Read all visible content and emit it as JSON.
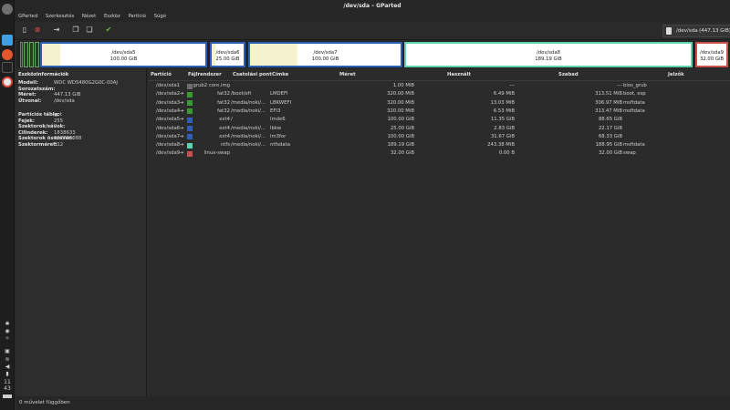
{
  "window": {
    "title": "/dev/sda – GParted"
  },
  "menu": [
    "GParted",
    "Szerkesztés",
    "Nézet",
    "Eszköz",
    "Partíció",
    "Súgó"
  ],
  "device_selector": {
    "name": "/dev/sda",
    "size": "(447.13 GiB)"
  },
  "disk_segments": [
    {
      "name": "/dev/sda5",
      "size": "100.00 GiB",
      "used_fraction": 0.113,
      "color": "#2f5fb4"
    },
    {
      "name": "/dev/sda6",
      "size": "25.00 GiB",
      "used_fraction": 0.11,
      "color": "#2f5fb4"
    },
    {
      "name": "/dev/sda7",
      "size": "100.00 GiB",
      "used_fraction": 0.317,
      "color": "#2f5fb4"
    },
    {
      "name": "/dev/sda8",
      "size": "189.19 GiB",
      "used_fraction": 0.0,
      "color": "#5fd2b0"
    },
    {
      "name": "/dev/sda9",
      "size": "32.00 GiB",
      "used_fraction": 0.0,
      "color": "#c9524e"
    }
  ],
  "info": {
    "title": "Eszközinformációk",
    "fields": [
      {
        "k": "Modell:",
        "v": "WDC WDS480G2G0C-00AJ"
      },
      {
        "k": "Sorozatszám:",
        "v": ""
      },
      {
        "k": "Méret:",
        "v": "447.13 GiB"
      },
      {
        "k": "Útvonal:",
        "v": "/dev/sda"
      }
    ],
    "fields2": [
      {
        "k": "Partíciós tábla:",
        "v": "gpt"
      },
      {
        "k": "Fejek:",
        "v": "255"
      },
      {
        "k": "Szektorok/sávok:",
        "v": "2"
      },
      {
        "k": "Cilinderek:",
        "v": "1838633"
      },
      {
        "k": "Szektorok összesen:",
        "v": "937703088"
      },
      {
        "k": "Szektorméret:",
        "v": "512"
      }
    ]
  },
  "columns": [
    "Partíció",
    "Fájlrendszer",
    "Csatolási pont",
    "Címke",
    "Méret",
    "Használt",
    "Szabad",
    "Jelzők"
  ],
  "rows": [
    {
      "part": "/dev/sda1",
      "fs": "grub2 core.img",
      "mount": "",
      "label": "",
      "size": "1.00 MiB",
      "used": "---",
      "free": "---",
      "flags": "bios_grub",
      "color": "#6e6e6e",
      "key": false
    },
    {
      "part": "/dev/sda2",
      "fs": "fat32",
      "mount": "/boot/efi",
      "label": "LMDEFI",
      "size": "320.00 MiB",
      "used": "6.49 MiB",
      "free": "313.51 MiB",
      "flags": "boot, esp",
      "color": "#3a9b35",
      "key": true
    },
    {
      "part": "/dev/sda3",
      "fs": "fat32",
      "mount": "/media/noki/...",
      "label": "LBKWEFI",
      "size": "320.00 MiB",
      "used": "13.03 MiB",
      "free": "306.97 MiB",
      "flags": "msftdata",
      "color": "#3a9b35",
      "key": true
    },
    {
      "part": "/dev/sda4",
      "fs": "fat32",
      "mount": "/media/noki/...",
      "label": "EFI3",
      "size": "320.00 MiB",
      "used": "6.53 MiB",
      "free": "313.47 MiB",
      "flags": "msftdata",
      "color": "#3a9b35",
      "key": true
    },
    {
      "part": "/dev/sda5",
      "fs": "ext4",
      "mount": "/",
      "label": "lmde6",
      "size": "100.00 GiB",
      "used": "11.35 GiB",
      "free": "88.65 GiB",
      "flags": "",
      "color": "#2f5fb4",
      "key": true
    },
    {
      "part": "/dev/sda6",
      "fs": "ext4",
      "mount": "/media/noki/...",
      "label": "lbkw",
      "size": "25.00 GiB",
      "used": "2.83 GiB",
      "free": "22.17 GiB",
      "flags": "",
      "color": "#2f5fb4",
      "key": true
    },
    {
      "part": "/dev/sda7",
      "fs": "ext4",
      "mount": "/media/noki/...",
      "label": "lm3for",
      "size": "100.00 GiB",
      "used": "31.67 GiB",
      "free": "68.33 GiB",
      "flags": "",
      "color": "#2f5fb4",
      "key": true
    },
    {
      "part": "/dev/sda8",
      "fs": "ntfs",
      "mount": "/media/noki/...",
      "label": "ntfsdata",
      "size": "189.19 GiB",
      "used": "243.38 MiB",
      "free": "188.95 GiB",
      "flags": "msftdata",
      "color": "#5fd2b0",
      "key": true
    },
    {
      "part": "/dev/sda9",
      "fs": "linux-swap",
      "mount": "",
      "label": "",
      "size": "32.00 GiB",
      "used": "0.00 B",
      "free": "32.00 GiB",
      "flags": "swap",
      "color": "#c9524e",
      "key": true
    }
  ],
  "status": "0 művelet függőben",
  "clock": {
    "h": "11",
    "m": "43"
  },
  "colors": {
    "accent": "#3a9b35",
    "ext4": "#2f5fb4",
    "ntfs": "#5fd2b0",
    "swap": "#c9524e"
  }
}
